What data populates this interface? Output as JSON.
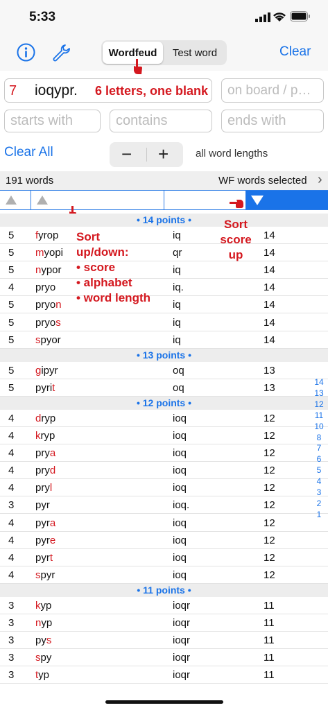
{
  "status_bar": {
    "time": "5:33"
  },
  "toolbar": {
    "segment_active": "Wordfeud",
    "segment_inactive": "Test word",
    "clear_label": "Clear"
  },
  "input": {
    "count": "7",
    "letters": "ioqypr.",
    "hint": "6 letters, one blank",
    "board_placeholder": "on board / p…"
  },
  "filters": {
    "starts_placeholder": "starts with",
    "contains_placeholder": "contains",
    "ends_placeholder": "ends with"
  },
  "controls": {
    "clear_all": "Clear All",
    "minus": "−",
    "plus": "+",
    "lengths": "all word lengths"
  },
  "summary": {
    "count": "191 words",
    "selection": "WF words selected",
    "chevron": "›"
  },
  "annotations": {
    "sort_list": [
      "Sort",
      "up/down:",
      "• score",
      "• alphabet",
      "• word length"
    ],
    "sort_score": [
      "Sort",
      "score",
      "up"
    ]
  },
  "accent_color": "#1a73e8",
  "highlight_color": "#d4181f",
  "groups": [
    {
      "header": "• 14 points •",
      "rows": [
        {
          "len": "5",
          "first": "f",
          "mid": "yrop",
          "last": "",
          "rest": "iq",
          "score": "14"
        },
        {
          "len": "5",
          "first": "m",
          "mid": "yopi",
          "last": "",
          "rest": "qr",
          "score": "14"
        },
        {
          "len": "5",
          "first": "n",
          "mid": "ypor",
          "last": "",
          "rest": "iq",
          "score": "14"
        },
        {
          "len": "4",
          "first": "",
          "mid": "pryo",
          "last": "",
          "rest": "iq.",
          "score": "14"
        },
        {
          "len": "5",
          "first": "",
          "mid": "pryo",
          "last": "n",
          "rest": "iq",
          "score": "14"
        },
        {
          "len": "5",
          "first": "",
          "mid": "pryo",
          "last": "s",
          "rest": "iq",
          "score": "14"
        },
        {
          "len": "5",
          "first": "s",
          "mid": "pyor",
          "last": "",
          "rest": "iq",
          "score": "14"
        }
      ]
    },
    {
      "header": "• 13 points •",
      "rows": [
        {
          "len": "5",
          "first": "g",
          "mid": "ipyr",
          "last": "",
          "rest": "oq",
          "score": "13"
        },
        {
          "len": "5",
          "first": "",
          "mid": "pyri",
          "last": "t",
          "rest": "oq",
          "score": "13"
        }
      ]
    },
    {
      "header": "• 12 points •",
      "rows": [
        {
          "len": "4",
          "first": "d",
          "mid": "ryp",
          "last": "",
          "rest": "ioq",
          "score": "12"
        },
        {
          "len": "4",
          "first": "k",
          "mid": "ryp",
          "last": "",
          "rest": "ioq",
          "score": "12"
        },
        {
          "len": "4",
          "first": "",
          "mid": "pry",
          "last": "a",
          "rest": "ioq",
          "score": "12"
        },
        {
          "len": "4",
          "first": "",
          "mid": "pry",
          "last": "d",
          "rest": "ioq",
          "score": "12"
        },
        {
          "len": "4",
          "first": "",
          "mid": "pry",
          "last": "l",
          "rest": "ioq",
          "score": "12"
        },
        {
          "len": "3",
          "first": "",
          "mid": "pyr",
          "last": "",
          "rest": "ioq.",
          "score": "12"
        },
        {
          "len": "4",
          "first": "",
          "mid": "pyr",
          "last": "a",
          "rest": "ioq",
          "score": "12"
        },
        {
          "len": "4",
          "first": "",
          "mid": "pyr",
          "last": "e",
          "rest": "ioq",
          "score": "12"
        },
        {
          "len": "4",
          "first": "",
          "mid": "pyr",
          "last": "t",
          "rest": "ioq",
          "score": "12"
        },
        {
          "len": "4",
          "first": "s",
          "mid": "pyr",
          "last": "",
          "rest": "ioq",
          "score": "12"
        }
      ]
    },
    {
      "header": "• 11 points •",
      "rows": [
        {
          "len": "3",
          "first": "k",
          "mid": "yp",
          "last": "",
          "rest": "ioqr",
          "score": "11"
        },
        {
          "len": "3",
          "first": "n",
          "mid": "yp",
          "last": "",
          "rest": "ioqr",
          "score": "11"
        },
        {
          "len": "3",
          "first": "",
          "mid": "py",
          "last": "s",
          "rest": "ioqr",
          "score": "11"
        },
        {
          "len": "3",
          "first": "s",
          "mid": "py",
          "last": "",
          "rest": "ioqr",
          "score": "11"
        },
        {
          "len": "3",
          "first": "t",
          "mid": "yp",
          "last": "",
          "rest": "ioqr",
          "score": "11"
        }
      ]
    }
  ],
  "index_bar": [
    "14",
    "13",
    "12",
    "11",
    "10",
    "8",
    "7",
    "6",
    "5",
    "4",
    "3",
    "2",
    "1"
  ]
}
